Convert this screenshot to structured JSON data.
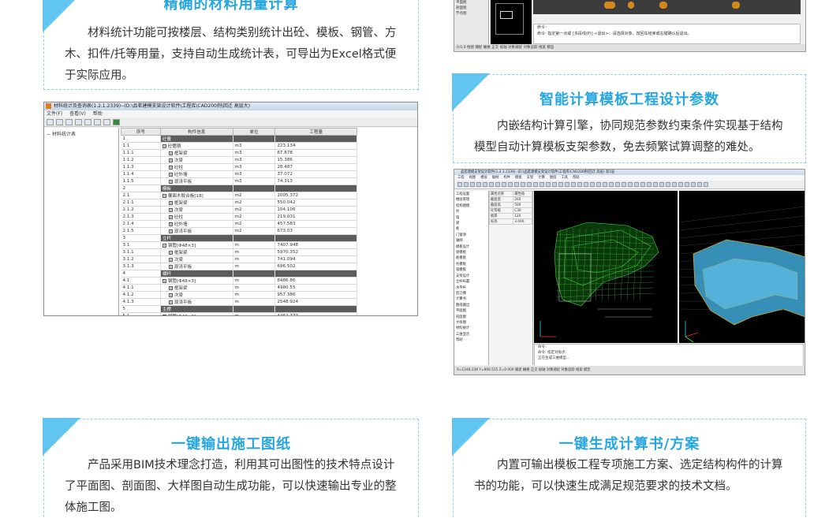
{
  "cards": {
    "stats": {
      "title": "精确的材料用量计算",
      "text": "材料统计功能可按楼层、结构类别统计出砼、模板、钢管、方木、扣件/托等用量，支持自动生成统计表，可导出为Excel格式便于实际应用。"
    },
    "smart": {
      "title": "智能计算模板工程设计参数",
      "text": "内嵌结构计算引擎，协同规范参数约束条件实现基于结构模型自动计算模板支架参数，免去频繁试算调整的难处。"
    },
    "drawings": {
      "title": "一键输出施工图纸",
      "text": "产品采用BIM技术理念打造，利用其可出图性的技术特点设计了平面图、剖面图、大样图自动生成功能，可以快速输出专业的整体施工图。"
    },
    "report": {
      "title": "一键生成计算书/方案",
      "text": "内置可输出模板工程专项施工方案、选定结构构件的计算书的功能，可以快速生成满足规范要求的技术文档。"
    }
  },
  "stats_window": {
    "title": "材料统计及查询表(1.2.1.2339)--(D:\\品茗建模支架设计软件\\工程库\\CAD200例\\回迁 高层大)",
    "menu": [
      "文件(F)",
      "查看(V)",
      "帮助"
    ],
    "tree_item": "材料统计表",
    "columns": [
      "序号",
      "构件信息",
      "单位",
      "工程量"
    ],
    "rows": [
      {
        "seq": "1",
        "info": "砼量",
        "unit": "",
        "qty": "",
        "header": true
      },
      {
        "seq": "1.1",
        "info": "砼體積",
        "unit": "m3",
        "qty": "223.134",
        "box": true
      },
      {
        "seq": "1.1.1",
        "info": "框架梁",
        "unit": "m3",
        "qty": "67.878",
        "box": true,
        "indent": true
      },
      {
        "seq": "1.1.2",
        "info": "次梁",
        "unit": "m3",
        "qty": "15.386",
        "box": true,
        "indent": true
      },
      {
        "seq": "1.1.3",
        "info": "砼柱",
        "unit": "m3",
        "qty": "28.487",
        "box": true,
        "indent": true
      },
      {
        "seq": "1.1.4",
        "info": "砼外墙",
        "unit": "m3",
        "qty": "37.072",
        "box": true,
        "indent": true
      },
      {
        "seq": "1.1.5",
        "info": "现浇平板",
        "unit": "m3",
        "qty": "74.313",
        "box": true,
        "indent": true
      },
      {
        "seq": "2",
        "info": "模板",
        "unit": "",
        "qty": "",
        "header": true
      },
      {
        "seq": "2.1",
        "info": "覆面木胶合板[18]",
        "unit": "m2",
        "qty": "2005.372",
        "box": true
      },
      {
        "seq": "2.1.1",
        "info": "框架梁",
        "unit": "m2",
        "qty": "550.042",
        "box": true,
        "indent": true
      },
      {
        "seq": "2.1.2",
        "info": "次梁",
        "unit": "m2",
        "qty": "104.106",
        "box": true,
        "indent": true
      },
      {
        "seq": "2.1.3",
        "info": "砼柱",
        "unit": "m2",
        "qty": "219.031",
        "box": true,
        "indent": true
      },
      {
        "seq": "2.1.4",
        "info": "砼外墙",
        "unit": "m2",
        "qty": "457.583",
        "box": true,
        "indent": true
      },
      {
        "seq": "2.1.5",
        "info": "现浇平板",
        "unit": "m2",
        "qty": "673.03",
        "box": true,
        "indent": true
      },
      {
        "seq": "3",
        "info": "立杆",
        "unit": "",
        "qty": "",
        "header": true
      },
      {
        "seq": "3.1",
        "info": "钢管[Φ48×3]",
        "unit": "m",
        "qty": "7407.948",
        "box": true
      },
      {
        "seq": "3.1.1",
        "info": "框架梁",
        "unit": "m",
        "qty": "5970.352",
        "box": true,
        "indent": true
      },
      {
        "seq": "3.1.2",
        "info": "次梁",
        "unit": "m",
        "qty": "741.094",
        "box": true,
        "indent": true
      },
      {
        "seq": "3.1.3",
        "info": "现浇平板",
        "unit": "m",
        "qty": "696.502",
        "box": true,
        "indent": true
      },
      {
        "seq": "4",
        "info": "横杆",
        "unit": "",
        "qty": "",
        "header": true
      },
      {
        "seq": "4.1",
        "info": "钢管[Φ48×3]",
        "unit": "m",
        "qty": "8486.86",
        "box": true
      },
      {
        "seq": "4.1.1",
        "info": "框架梁",
        "unit": "m",
        "qty": "4980.55",
        "box": true,
        "indent": true
      },
      {
        "seq": "4.1.2",
        "info": "次梁",
        "unit": "m",
        "qty": "957.386",
        "box": true,
        "indent": true
      },
      {
        "seq": "4.1.3",
        "info": "现浇平板",
        "unit": "m",
        "qty": "2548.924",
        "box": true,
        "indent": true
      },
      {
        "seq": "5",
        "info": "主楞",
        "unit": "",
        "qty": "",
        "header": true
      },
      {
        "seq": "5.1",
        "info": "钢管[Φ48×3]",
        "unit": "m",
        "qty": "4462.777",
        "box": true
      }
    ]
  },
  "cad_top": {
    "left_items": [
      "",
      "",
      "",
      "",
      "平面图",
      "剖面图",
      "节点图"
    ],
    "cmd_lines": [
      "命令：",
      "命令: 指定第一点或 [多段线(P)] <退出>：请选择对象，按回车结束或右键确认后退出。"
    ],
    "status": "0,0,0 绘图 捕捉 栅格 正交 极轴 对象捕捉 对象追踪 线宽 模型"
  },
  "cad_3d": {
    "title": "品茗建模支架设计软件(1.2.1.2339) -(D:\\品茗建模支架设计软件\\工程库\\CAD200例\\回迁 高层) 第1层",
    "menus": [
      "工程",
      "视图",
      "楼层",
      "轴网",
      "构件",
      "模板",
      "支架",
      "计算",
      "图纸",
      "工具",
      "帮助"
    ],
    "left_items": [
      "工程设置",
      "楼层管理",
      "结构建模",
      "柱",
      "墙",
      "梁",
      "板",
      "门窗洞",
      "轴网",
      "模板设计",
      "梁模板",
      "板模板",
      "柱模板",
      "墙模板",
      "支架设计",
      "立杆布置",
      "水平杆",
      "剪刀撑",
      "计算书",
      "图纸输出",
      "平面图",
      "剖面图",
      "大样图",
      "材料统计",
      "三维显示",
      "帮助"
    ],
    "props": [
      "属性名称",
      "属性值",
      "截面宽",
      "200",
      "截面高",
      "500",
      "砼等级",
      "C30",
      "板厚",
      "120",
      "标高",
      "3.000"
    ],
    "cmd_lines": [
      "命令：",
      "命令: 指定对角点：",
      "正在生成三维模型..."
    ],
    "status": "X=1248.236 Y=866.515 Z=0.000 捕捉 栅格 正交 极轴 对象捕捉 对象追踪 线宽 模型"
  }
}
